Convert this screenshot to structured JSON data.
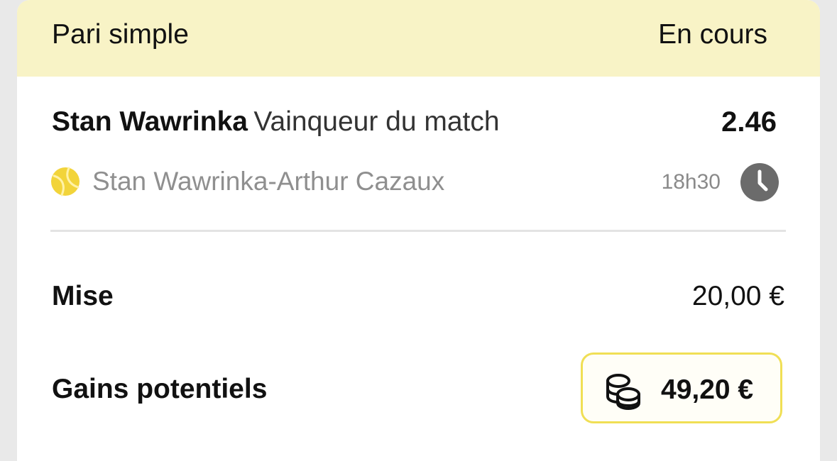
{
  "header": {
    "title": "Pari simple",
    "status": "En cours"
  },
  "selection": {
    "player": "Stan Wawrinka",
    "market": "Vainqueur du match",
    "odds": "2.46"
  },
  "event": {
    "sport_icon": "tennis-ball-icon",
    "name": "Stan Wawrinka-Arthur Cazaux",
    "time": "18h30",
    "time_icon": "clock-icon"
  },
  "stake": {
    "label": "Mise",
    "value": "20,00 €"
  },
  "potential_gains": {
    "label": "Gains potentiels",
    "icon": "coins-icon",
    "value": "49,20 €"
  },
  "colors": {
    "header_background": "#f8f3c6",
    "accent_yellow": "#f0df55",
    "tennis_ball": "#f2d43a",
    "clock": "#6b6b6b",
    "muted_text": "#8f8f8f"
  }
}
